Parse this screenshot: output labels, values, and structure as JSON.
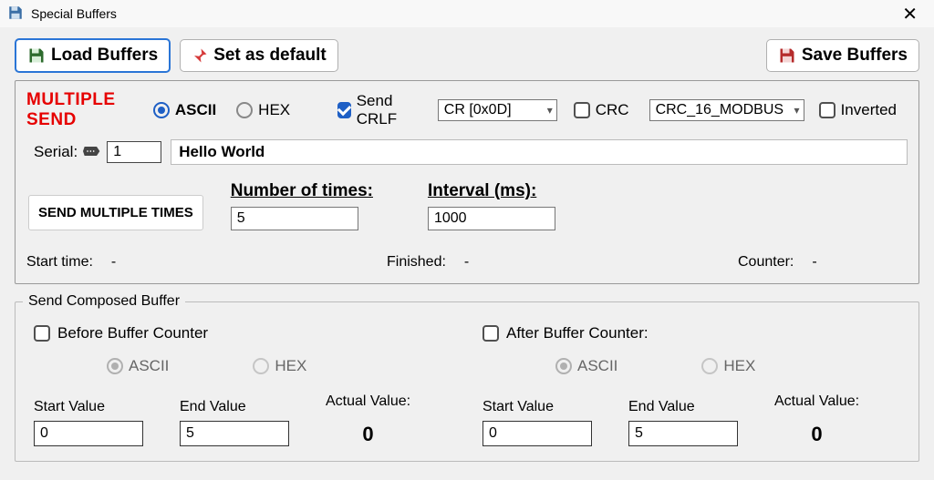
{
  "window": {
    "title": "Special Buffers"
  },
  "toolbar": {
    "load": "Load Buffers",
    "setdefault": "Set as default",
    "save": "Save Buffers"
  },
  "multisend": {
    "label": "MULTIPLE SEND",
    "ascii": "ASCII",
    "hex": "HEX",
    "sendcrlf": "Send CRLF",
    "lineend_value": "CR [0x0D]",
    "crc": "CRC",
    "crc_value": "CRC_16_MODBUS",
    "inverted": "Inverted",
    "serial_label": "Serial:",
    "serial_num": "1",
    "payload": "Hello World",
    "send_multi_btn": "SEND MULTIPLE TIMES",
    "numtimes_label": "Number of times:",
    "numtimes": "5",
    "interval_label": "Interval (ms):",
    "interval": "1000",
    "start_lbl": "Start time:",
    "start_val": "-",
    "finished_lbl": "Finished:",
    "finished_val": "-",
    "counter_lbl": "Counter:",
    "counter_val": "-"
  },
  "compose": {
    "legend": "Send Composed Buffer",
    "before": {
      "title": "Before Buffer Counter",
      "ascii": "ASCII",
      "hex": "HEX",
      "start_lbl": "Start Value",
      "start": "0",
      "end_lbl": "End Value",
      "end": "5",
      "actual_lbl": "Actual Value:",
      "actual": "0"
    },
    "after": {
      "title": "After Buffer Counter:",
      "ascii": "ASCII",
      "hex": "HEX",
      "start_lbl": "Start Value",
      "start": "0",
      "end_lbl": "End Value",
      "end": "5",
      "actual_lbl": "Actual Value:",
      "actual": "0"
    }
  }
}
